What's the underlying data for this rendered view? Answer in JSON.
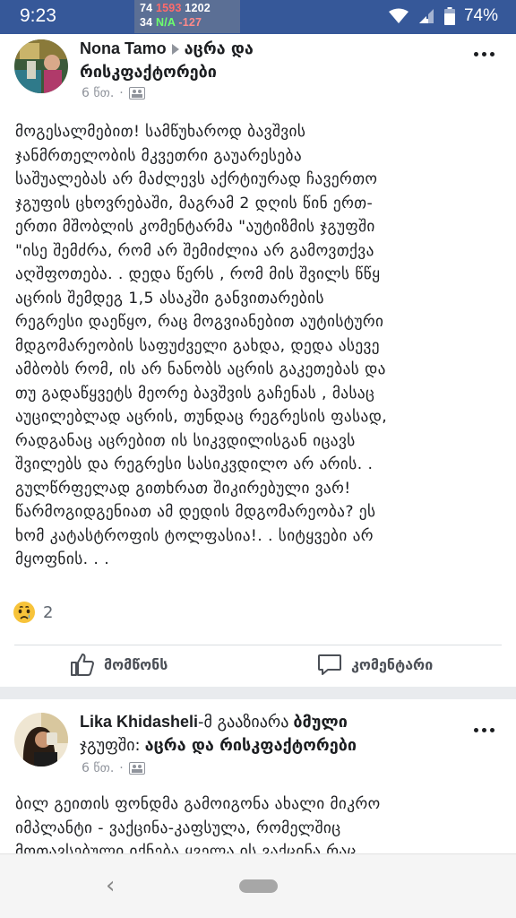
{
  "status_bar": {
    "time": "9:23",
    "overlay_line1": [
      "74",
      "1593",
      "1202"
    ],
    "overlay_line2": [
      "34",
      "N/A",
      "-127"
    ],
    "battery": "74%",
    "icons": [
      "wifi-icon",
      "signal-icon",
      "battery-icon"
    ]
  },
  "post1": {
    "author": "Nona Tamo",
    "group": "აცრა და",
    "group_line2": "რისკფაქტორები",
    "time": "6 წთ.",
    "privacy_icon": "group-privacy-icon",
    "lines": [
      "მოგესალმებით! სამწუხაროდ ბავშვის",
      "ჯანმრთელობის მკვეთრი გაუარესება",
      "საშუალებას არ მაძლევს აქრტიურად ჩავერთო",
      "ჯგუფის ცხოვრებაში, მაგრამ 2 დღის წინ ერთ-",
      "ერთი მშობლის კომენტარმა \"აუტიზმის ჯგუფში",
      "\"ისე შემძრა, რომ არ შემიძლია არ გამოვთქვა",
      "აღშფოთება. . დედა წერს , რომ მის შვილს წწყ",
      "აცრის შემდეგ 1,5 ასაკში განვითარების",
      "რეგრესი დაეწყო, რაც მოგვიანებით აუტისტური",
      "მდგომარეობის საფუძველი გახდა, დედა ასევე",
      "ამბობს რომ, ის არ ნანობს აცრის გაკეთებას და",
      "თუ გადაწყვეტს მეორე ბავშვის გაჩენას , მასაც",
      "აუცილებლად აცრის, თუნდაც რეგრესის ფასად,",
      "რადგანაც აცრებით ის სიკვდილისგან იცავს",
      "შვილებს და რეგრესი სასიკვდილო არ არის. .",
      "გულწრფელად გითხრათ შიკირებული ვარ!",
      "წარმოგიდგენიათ ამ დედის მდგომარეობა? ეს",
      "ხომ კატასტროფის ტოლფასია!. . სიტყვები არ",
      "მყოფნის. . ."
    ],
    "reaction_icon": "sad-reaction-icon",
    "reaction_count": "2",
    "like_label": "მომწონს",
    "comment_label": "კომენტარი"
  },
  "post2": {
    "author": "Lika Khidasheli",
    "shared_prefix": "-მ გააზიარა",
    "shared_bold": "ბმული",
    "line2_prefix": "ჯგუფში:",
    "group": "აცრა და რისკფაქტორები",
    "time": "6 წთ.",
    "lines": [
      "ბილ გეითის ფონდმა გამოიგონა ახალი მიკრო",
      "იმპლანტი - ვაქცინა-კაფსულა, რომელშიც",
      "მოთავსებული იქნება ყველა ის ვაქცინა რაც"
    ]
  },
  "colors": {
    "facebook_blue": "#365899",
    "text": "#1c1e21",
    "muted": "#90949c"
  }
}
